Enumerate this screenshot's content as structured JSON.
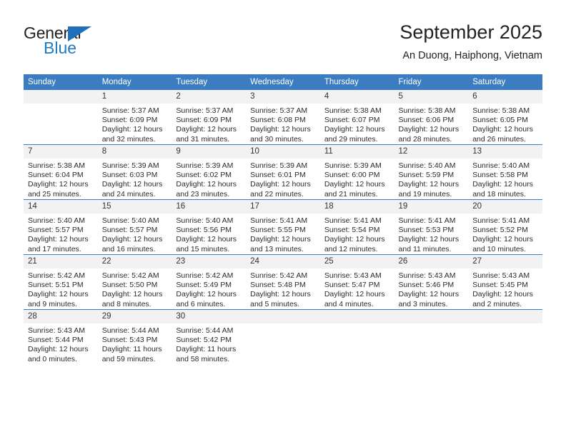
{
  "logo": {
    "word_primary": "General",
    "word_secondary": "Blue",
    "triangle_icon": "triangle-icon",
    "primary_color": "#231f20",
    "accent_color": "#1f7ac4"
  },
  "header": {
    "title": "September 2025",
    "subtitle": "An Duong, Haiphong, Vietnam"
  },
  "theme": {
    "header_row_bg": "#3b7dc0",
    "daynum_bg": "#f2f2f2",
    "row_divider": "#3b7dc0",
    "text": "#2b2b2b"
  },
  "columns": [
    "Sunday",
    "Monday",
    "Tuesday",
    "Wednesday",
    "Thursday",
    "Friday",
    "Saturday"
  ],
  "weeks": [
    [
      {
        "day": "",
        "blank": true,
        "sunrise": "",
        "sunset": "",
        "daylight1": "",
        "daylight2": ""
      },
      {
        "day": "1",
        "sunrise": "Sunrise: 5:37 AM",
        "sunset": "Sunset: 6:09 PM",
        "daylight1": "Daylight: 12 hours",
        "daylight2": "and 32 minutes."
      },
      {
        "day": "2",
        "sunrise": "Sunrise: 5:37 AM",
        "sunset": "Sunset: 6:09 PM",
        "daylight1": "Daylight: 12 hours",
        "daylight2": "and 31 minutes."
      },
      {
        "day": "3",
        "sunrise": "Sunrise: 5:37 AM",
        "sunset": "Sunset: 6:08 PM",
        "daylight1": "Daylight: 12 hours",
        "daylight2": "and 30 minutes."
      },
      {
        "day": "4",
        "sunrise": "Sunrise: 5:38 AM",
        "sunset": "Sunset: 6:07 PM",
        "daylight1": "Daylight: 12 hours",
        "daylight2": "and 29 minutes."
      },
      {
        "day": "5",
        "sunrise": "Sunrise: 5:38 AM",
        "sunset": "Sunset: 6:06 PM",
        "daylight1": "Daylight: 12 hours",
        "daylight2": "and 28 minutes."
      },
      {
        "day": "6",
        "sunrise": "Sunrise: 5:38 AM",
        "sunset": "Sunset: 6:05 PM",
        "daylight1": "Daylight: 12 hours",
        "daylight2": "and 26 minutes."
      }
    ],
    [
      {
        "day": "7",
        "sunrise": "Sunrise: 5:38 AM",
        "sunset": "Sunset: 6:04 PM",
        "daylight1": "Daylight: 12 hours",
        "daylight2": "and 25 minutes."
      },
      {
        "day": "8",
        "sunrise": "Sunrise: 5:39 AM",
        "sunset": "Sunset: 6:03 PM",
        "daylight1": "Daylight: 12 hours",
        "daylight2": "and 24 minutes."
      },
      {
        "day": "9",
        "sunrise": "Sunrise: 5:39 AM",
        "sunset": "Sunset: 6:02 PM",
        "daylight1": "Daylight: 12 hours",
        "daylight2": "and 23 minutes."
      },
      {
        "day": "10",
        "sunrise": "Sunrise: 5:39 AM",
        "sunset": "Sunset: 6:01 PM",
        "daylight1": "Daylight: 12 hours",
        "daylight2": "and 22 minutes."
      },
      {
        "day": "11",
        "sunrise": "Sunrise: 5:39 AM",
        "sunset": "Sunset: 6:00 PM",
        "daylight1": "Daylight: 12 hours",
        "daylight2": "and 21 minutes."
      },
      {
        "day": "12",
        "sunrise": "Sunrise: 5:40 AM",
        "sunset": "Sunset: 5:59 PM",
        "daylight1": "Daylight: 12 hours",
        "daylight2": "and 19 minutes."
      },
      {
        "day": "13",
        "sunrise": "Sunrise: 5:40 AM",
        "sunset": "Sunset: 5:58 PM",
        "daylight1": "Daylight: 12 hours",
        "daylight2": "and 18 minutes."
      }
    ],
    [
      {
        "day": "14",
        "sunrise": "Sunrise: 5:40 AM",
        "sunset": "Sunset: 5:57 PM",
        "daylight1": "Daylight: 12 hours",
        "daylight2": "and 17 minutes."
      },
      {
        "day": "15",
        "sunrise": "Sunrise: 5:40 AM",
        "sunset": "Sunset: 5:57 PM",
        "daylight1": "Daylight: 12 hours",
        "daylight2": "and 16 minutes."
      },
      {
        "day": "16",
        "sunrise": "Sunrise: 5:40 AM",
        "sunset": "Sunset: 5:56 PM",
        "daylight1": "Daylight: 12 hours",
        "daylight2": "and 15 minutes."
      },
      {
        "day": "17",
        "sunrise": "Sunrise: 5:41 AM",
        "sunset": "Sunset: 5:55 PM",
        "daylight1": "Daylight: 12 hours",
        "daylight2": "and 13 minutes."
      },
      {
        "day": "18",
        "sunrise": "Sunrise: 5:41 AM",
        "sunset": "Sunset: 5:54 PM",
        "daylight1": "Daylight: 12 hours",
        "daylight2": "and 12 minutes."
      },
      {
        "day": "19",
        "sunrise": "Sunrise: 5:41 AM",
        "sunset": "Sunset: 5:53 PM",
        "daylight1": "Daylight: 12 hours",
        "daylight2": "and 11 minutes."
      },
      {
        "day": "20",
        "sunrise": "Sunrise: 5:41 AM",
        "sunset": "Sunset: 5:52 PM",
        "daylight1": "Daylight: 12 hours",
        "daylight2": "and 10 minutes."
      }
    ],
    [
      {
        "day": "21",
        "sunrise": "Sunrise: 5:42 AM",
        "sunset": "Sunset: 5:51 PM",
        "daylight1": "Daylight: 12 hours",
        "daylight2": "and 9 minutes."
      },
      {
        "day": "22",
        "sunrise": "Sunrise: 5:42 AM",
        "sunset": "Sunset: 5:50 PM",
        "daylight1": "Daylight: 12 hours",
        "daylight2": "and 8 minutes."
      },
      {
        "day": "23",
        "sunrise": "Sunrise: 5:42 AM",
        "sunset": "Sunset: 5:49 PM",
        "daylight1": "Daylight: 12 hours",
        "daylight2": "and 6 minutes."
      },
      {
        "day": "24",
        "sunrise": "Sunrise: 5:42 AM",
        "sunset": "Sunset: 5:48 PM",
        "daylight1": "Daylight: 12 hours",
        "daylight2": "and 5 minutes."
      },
      {
        "day": "25",
        "sunrise": "Sunrise: 5:43 AM",
        "sunset": "Sunset: 5:47 PM",
        "daylight1": "Daylight: 12 hours",
        "daylight2": "and 4 minutes."
      },
      {
        "day": "26",
        "sunrise": "Sunrise: 5:43 AM",
        "sunset": "Sunset: 5:46 PM",
        "daylight1": "Daylight: 12 hours",
        "daylight2": "and 3 minutes."
      },
      {
        "day": "27",
        "sunrise": "Sunrise: 5:43 AM",
        "sunset": "Sunset: 5:45 PM",
        "daylight1": "Daylight: 12 hours",
        "daylight2": "and 2 minutes."
      }
    ],
    [
      {
        "day": "28",
        "sunrise": "Sunrise: 5:43 AM",
        "sunset": "Sunset: 5:44 PM",
        "daylight1": "Daylight: 12 hours",
        "daylight2": "and 0 minutes."
      },
      {
        "day": "29",
        "sunrise": "Sunrise: 5:44 AM",
        "sunset": "Sunset: 5:43 PM",
        "daylight1": "Daylight: 11 hours",
        "daylight2": "and 59 minutes."
      },
      {
        "day": "30",
        "sunrise": "Sunrise: 5:44 AM",
        "sunset": "Sunset: 5:42 PM",
        "daylight1": "Daylight: 11 hours",
        "daylight2": "and 58 minutes."
      },
      {
        "day": "",
        "blank": true,
        "sunrise": "",
        "sunset": "",
        "daylight1": "",
        "daylight2": ""
      },
      {
        "day": "",
        "blank": true,
        "sunrise": "",
        "sunset": "",
        "daylight1": "",
        "daylight2": ""
      },
      {
        "day": "",
        "blank": true,
        "sunrise": "",
        "sunset": "",
        "daylight1": "",
        "daylight2": ""
      },
      {
        "day": "",
        "blank": true,
        "sunrise": "",
        "sunset": "",
        "daylight1": "",
        "daylight2": ""
      }
    ]
  ]
}
